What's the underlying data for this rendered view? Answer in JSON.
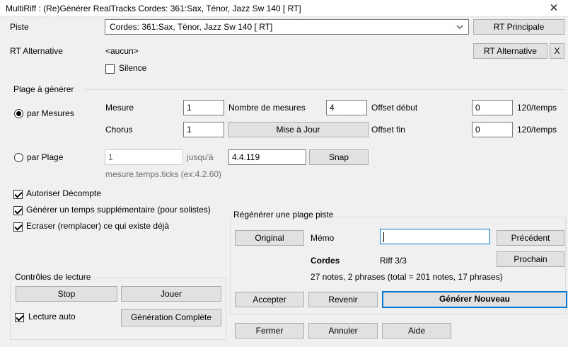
{
  "window": {
    "title": "MultiRiff : (Re)Générer RealTracks   Cordes: 361:Sax, Ténor, Jazz Sw 140 [ RT]",
    "close_icon": "close-icon"
  },
  "track": {
    "label": "Piste",
    "selected": "Cordes: 361:Sax, Ténor, Jazz Sw 140 [ RT]",
    "rt_main_button": "RT Principale"
  },
  "alt": {
    "label": "RT Alternative",
    "value": "<aucun>",
    "button": "RT Alternative",
    "clear_button": "X",
    "silence_label": "Silence",
    "silence_checked": false
  },
  "range": {
    "group_label": "Plage à générer",
    "by_measures_label": "par Mesures",
    "by_measures_selected": true,
    "mesure_label": "Mesure",
    "mesure_value": "1",
    "nb_mesures_label": "Nombre de mesures",
    "nb_mesures_value": "4",
    "offset_debut_label": "Offset début",
    "offset_debut_value": "0",
    "unit_1": "120/temps",
    "chorus_label": "Chorus",
    "chorus_value": "1",
    "update_button": "Mise à Jour",
    "offset_fin_label": "Offset fin",
    "offset_fin_value": "0",
    "unit_2": "120/temps",
    "by_range_label": "par Plage",
    "by_range_selected": false,
    "from_value": "1",
    "to_label": "jusqu'à",
    "to_value": "4.4.119",
    "snap_button": "Snap",
    "format_hint": "mesure.temps.ticks (ex:4.2.60)"
  },
  "options": {
    "count_in_label": "Autoriser Décompte",
    "count_in_checked": true,
    "extra_beat_label": "Générer un temps supplémentaire (pour solistes)",
    "extra_beat_checked": true,
    "overwrite_label": "Ecraser (remplacer) ce qui existe déjà",
    "overwrite_checked": true
  },
  "playback": {
    "group_label": "Contrôles de lecture",
    "stop_button": "Stop",
    "play_button": "Jouer",
    "autoplay_label": "Lecture auto",
    "autoplay_checked": true,
    "full_gen_button": "Génération Complète"
  },
  "regen": {
    "group_label": "Régénérer une plage piste",
    "original_button": "Original",
    "memo_label": "Mémo",
    "memo_value": "",
    "prev_button": "Précédent",
    "next_button": "Prochain",
    "track_name": "Cordes",
    "riff_counter": "Riff 3/3",
    "stats": "27 notes, 2 phrases (total = 201 notes, 17 phrases)",
    "accept_button": "Accepter",
    "revert_button": "Revenir",
    "generate_button": "Générer Nouveau"
  },
  "footer": {
    "close_button": "Fermer",
    "cancel_button": "Annuler",
    "help_button": "Aide"
  }
}
